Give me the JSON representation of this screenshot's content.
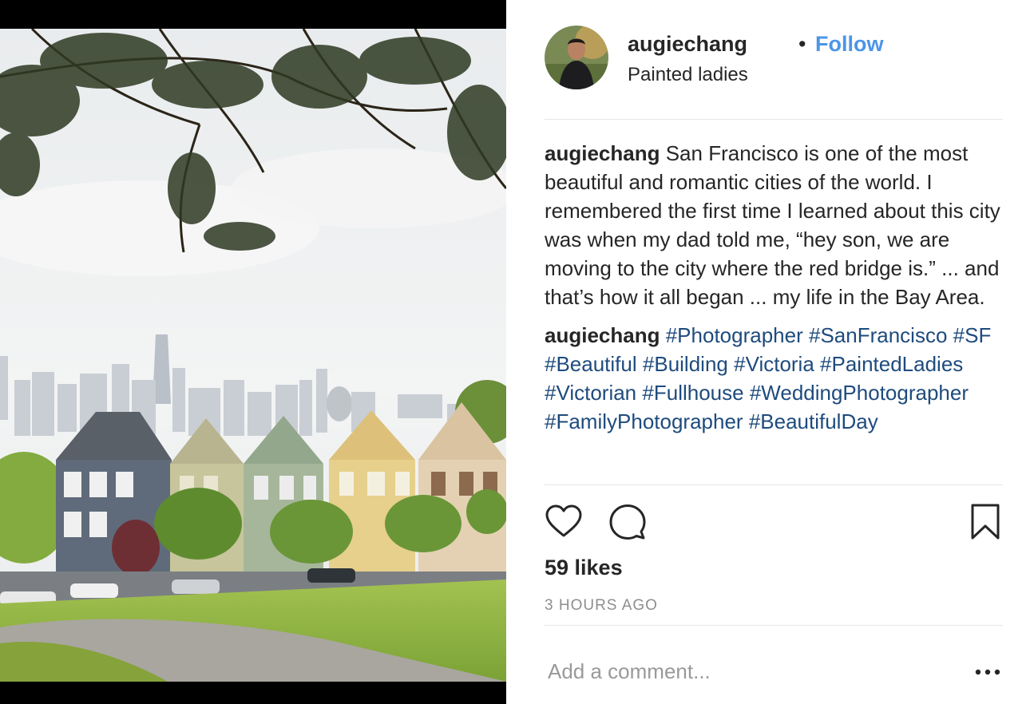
{
  "post": {
    "username": "augiechang",
    "separator": "•",
    "follow_label": "Follow",
    "location": "Painted ladies",
    "caption": {
      "user": "augiechang",
      "text": " San Francisco is one of the most beautiful and romantic cities of the world. I remembered the first time I learned about this city was when my dad told me, “hey son, we are moving to the city where the red bridge is.” ... and that’s how it all began ... my life in the Bay Area."
    },
    "hashtag_comment": {
      "user": "augiechang",
      "tags": [
        "#Photographer",
        "#SanFrancisco",
        "#SF",
        "#Beautiful",
        "#Building",
        "#Victoria",
        "#PaintedLadies",
        "#Victorian",
        "#Fullhouse",
        "#WeddingPhotographer",
        "#FamilyPhotographer",
        "#BeautifulDay"
      ]
    },
    "likes": "59 likes",
    "timestamp": "3 HOURS AGO",
    "comment_placeholder": "Add a comment..."
  },
  "icons": {
    "like": "heart-icon",
    "comment": "speech-bubble-icon",
    "save": "bookmark-icon",
    "more": "ellipsis-icon"
  },
  "colors": {
    "follow": "#4c95e8",
    "hashtag": "#1e4b7d",
    "muted": "#8e8e8e",
    "divider": "#e6e6e6"
  }
}
